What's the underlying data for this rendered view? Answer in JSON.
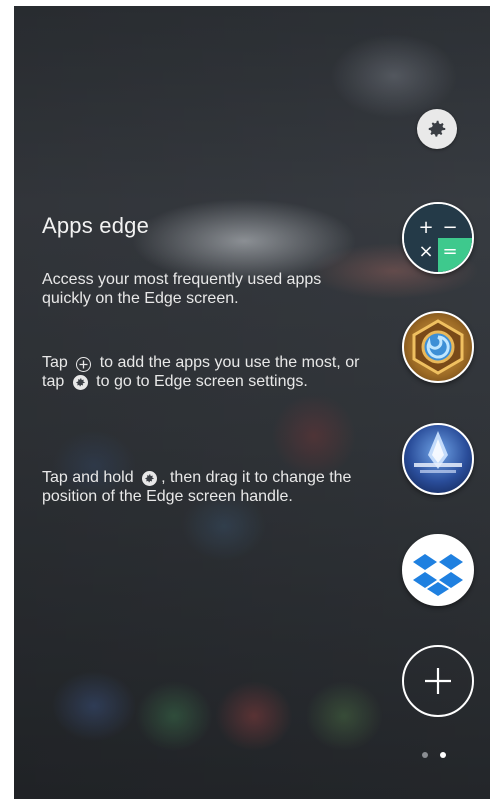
{
  "edge_panel": {
    "title": "Apps edge",
    "description": "Access your most frequently used apps quickly on the Edge screen.",
    "add_hint": {
      "before": "Tap",
      "middle": "to add the apps you use the most, or tap",
      "after": "to go to Edge screen settings."
    },
    "move_hint": {
      "before": "Tap and hold",
      "after": ", then drag it to change the position of the Edge screen handle."
    },
    "calculator_symbols": [
      "+",
      "−",
      "×",
      "="
    ],
    "icons": {
      "settings": "gear-icon",
      "calculator": "calculator-icon",
      "hearthstone": "hearthstone-icon",
      "final_fantasy": "final-fantasy-icon",
      "dropbox": "dropbox-icon",
      "add": "plus-icon"
    },
    "page_indicator": {
      "total": 2,
      "active": 2
    }
  },
  "colors": {
    "background": "#33373c",
    "text": "#e8e8e8",
    "calculator_green": "#3ec98d",
    "dropbox_blue": "#1f80e0"
  }
}
